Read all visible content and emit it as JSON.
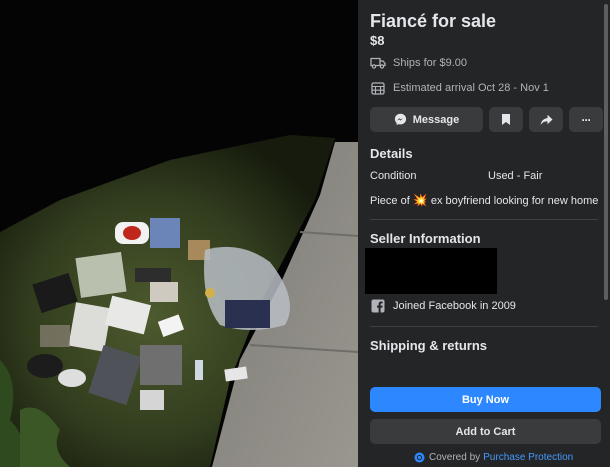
{
  "listing": {
    "title": "Fiancé for sale",
    "price": "$8",
    "shipping_text": "Ships for $9.00",
    "arrival_text": "Estimated arrival Oct 28 - Nov 1"
  },
  "actions": {
    "message_label": "Message",
    "save_icon": "bookmark-icon",
    "share_icon": "share-icon",
    "more_label": "···"
  },
  "details": {
    "heading": "Details",
    "condition_label": "Condition",
    "condition_value": "Used - Fair",
    "description_before": "Piece of",
    "description_emoji": "💥",
    "description_after": "ex boyfriend looking for new home"
  },
  "seller": {
    "heading": "Seller Information",
    "joined_text": "Joined Facebook in 2009"
  },
  "shipping": {
    "heading": "Shipping & returns"
  },
  "footer": {
    "buy_label": "Buy Now",
    "cart_label": "Add to Cart",
    "covered_text": "Covered by",
    "protection_link": "Purchase Protection"
  },
  "colors": {
    "panel_bg": "#242526",
    "button_bg": "#3a3b3c",
    "primary": "#2d88ff",
    "link": "#4599ff",
    "text": "#e4e6eb",
    "muted": "#b0b3b8"
  }
}
